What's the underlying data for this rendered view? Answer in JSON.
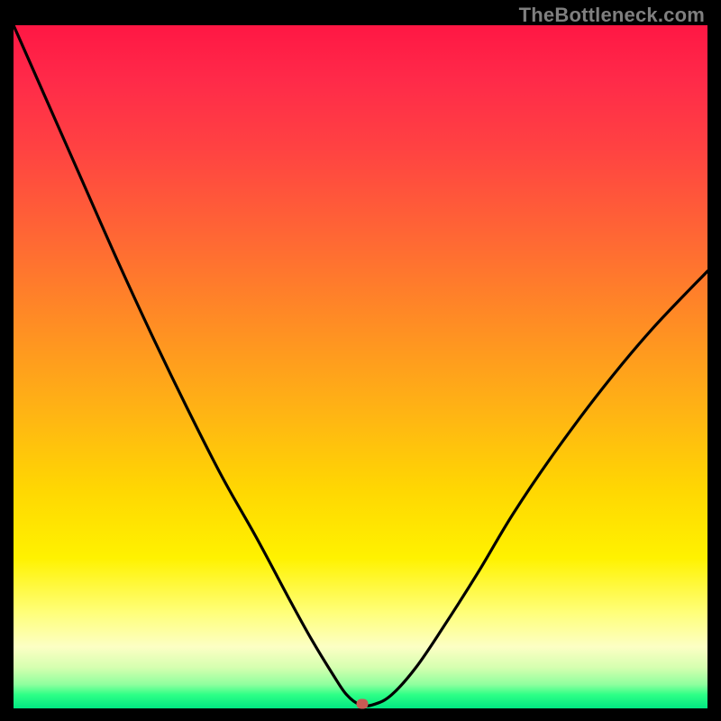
{
  "watermark": "TheBottleneck.com",
  "marker": {
    "x_frac": 0.503,
    "y_frac": 0.993
  },
  "chart_data": {
    "type": "line",
    "title": "",
    "xlabel": "",
    "ylabel": "",
    "xlim": [
      0,
      1
    ],
    "ylim": [
      0,
      1
    ],
    "series": [
      {
        "name": "bottleneck-curve",
        "x": [
          0.0,
          0.05,
          0.1,
          0.15,
          0.2,
          0.25,
          0.3,
          0.35,
          0.4,
          0.43,
          0.46,
          0.48,
          0.5,
          0.52,
          0.545,
          0.58,
          0.62,
          0.67,
          0.72,
          0.78,
          0.85,
          0.92,
          1.0
        ],
        "y": [
          1.0,
          0.885,
          0.77,
          0.655,
          0.545,
          0.44,
          0.34,
          0.25,
          0.155,
          0.1,
          0.05,
          0.02,
          0.005,
          0.006,
          0.02,
          0.06,
          0.12,
          0.2,
          0.285,
          0.375,
          0.47,
          0.555,
          0.64
        ]
      }
    ],
    "annotations": [],
    "legend": false,
    "grid": false,
    "background_gradient": {
      "top_color": "#ff1744",
      "bottom_color": "#00e882"
    }
  }
}
